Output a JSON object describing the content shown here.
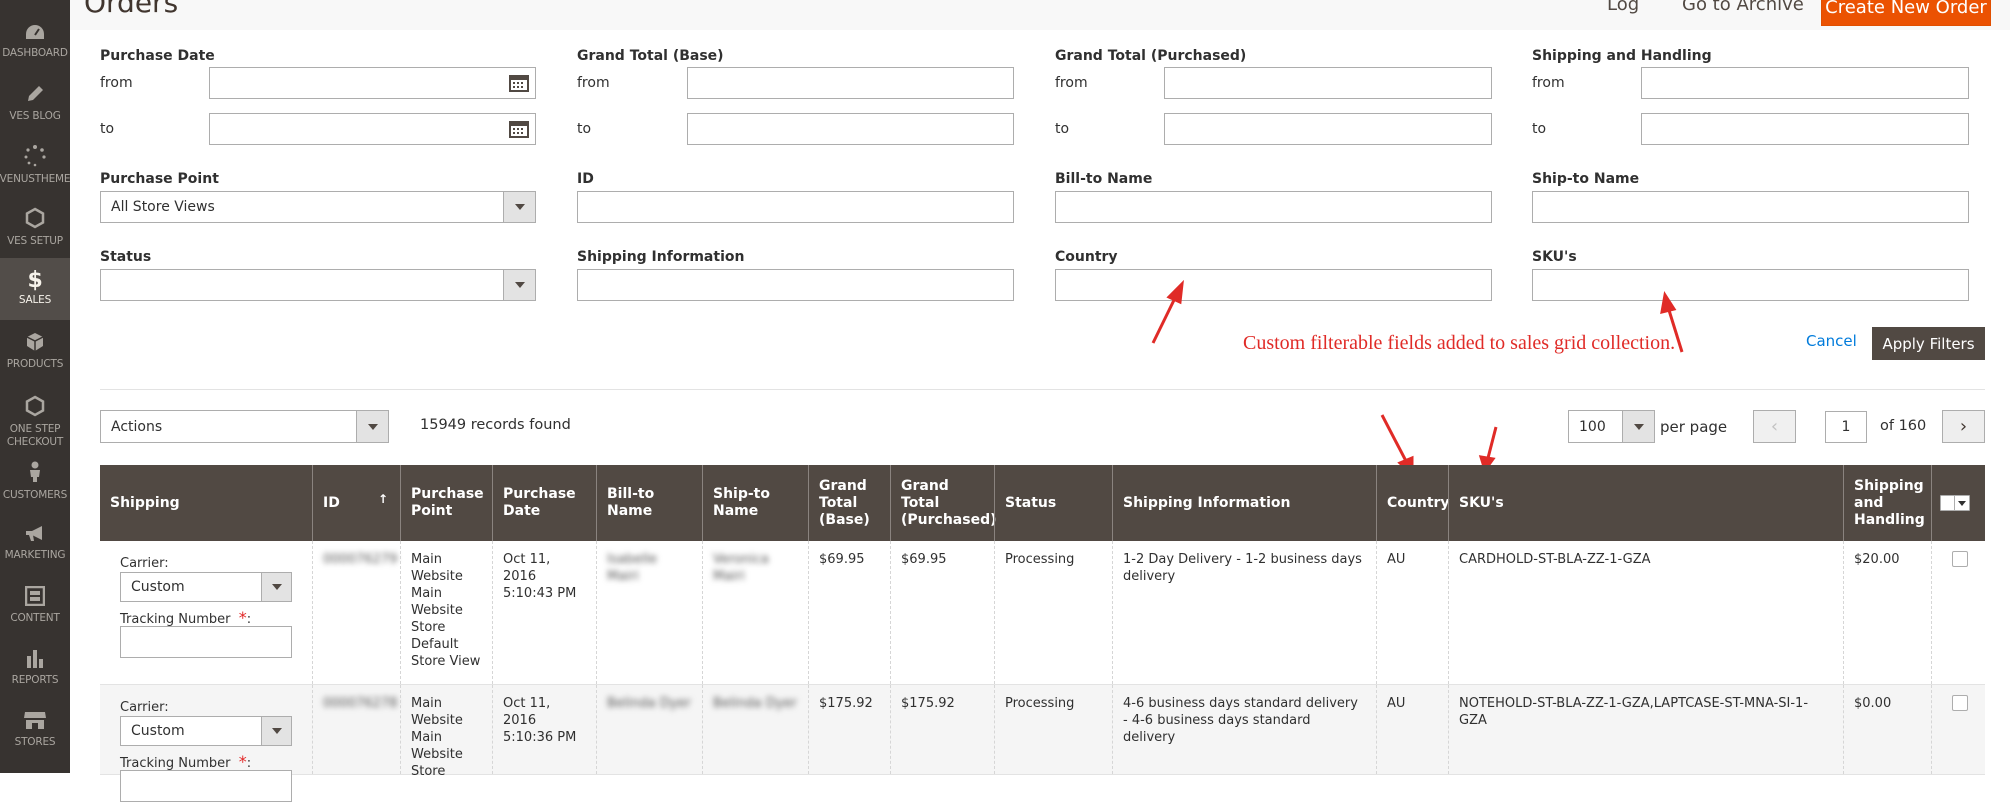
{
  "sidebar": {
    "items": [
      {
        "icon": "dashboard-icon",
        "label": "DASHBOARD"
      },
      {
        "icon": "pencil-icon",
        "label": "VES BLOG"
      },
      {
        "icon": "dots-spinner-icon",
        "label": "VENUSTHEME"
      },
      {
        "icon": "hexagon-icon",
        "label": "VES SETUP"
      },
      {
        "icon": "dollar-icon",
        "label": "SALES"
      },
      {
        "icon": "cube-icon",
        "label": "PRODUCTS"
      },
      {
        "icon": "hexagon-icon",
        "label": "ONE STEP CHECKOUT"
      },
      {
        "icon": "person-icon",
        "label": "CUSTOMERS"
      },
      {
        "icon": "megaphone-icon",
        "label": "MARKETING"
      },
      {
        "icon": "content-icon",
        "label": "CONTENT"
      },
      {
        "icon": "bar-chart-icon",
        "label": "REPORTS"
      },
      {
        "icon": "store-icon",
        "label": "STORES"
      }
    ],
    "active": "SALES"
  },
  "header": {
    "title": "Orders",
    "log_link": "Log",
    "archive_link": "Go to Archive",
    "create_button": "Create New Order",
    "accent_color": "#eb5202"
  },
  "filters": {
    "purchase_date": {
      "label": "Purchase Date",
      "from": "from",
      "to": "to"
    },
    "grand_total_base": {
      "label": "Grand Total (Base)",
      "from": "from",
      "to": "to"
    },
    "grand_total_purchased": {
      "label": "Grand Total (Purchased)",
      "from": "from",
      "to": "to"
    },
    "shipping_handling": {
      "label": "Shipping and Handling",
      "from": "from",
      "to": "to"
    },
    "purchase_point": {
      "label": "Purchase Point",
      "value": "All Store Views"
    },
    "id": {
      "label": "ID"
    },
    "bill_to": {
      "label": "Bill-to Name"
    },
    "ship_to": {
      "label": "Ship-to Name"
    },
    "status": {
      "label": "Status",
      "value": ""
    },
    "shipping_info": {
      "label": "Shipping Information"
    },
    "country": {
      "label": "Country"
    },
    "skus": {
      "label": "SKU's"
    },
    "cancel": "Cancel",
    "apply": "Apply Filters"
  },
  "annotation": {
    "text": "Custom filterable fields added to sales grid collection.",
    "color": "#e02b27"
  },
  "toolbar": {
    "actions": "Actions",
    "records": "15949 records found",
    "per_page_value": "100",
    "per_page_label": "per page",
    "current_page": "1",
    "of_pages": "of 160"
  },
  "grid": {
    "columns": [
      "Shipping",
      "ID",
      "Purchase Point",
      "Purchase Date",
      "Bill-to Name",
      "Ship-to Name",
      "Grand Total (Base)",
      "Grand Total (Purchased)",
      "Status",
      "Shipping Information",
      "Country",
      "SKU's",
      "Shipping and Handling"
    ],
    "shipping_labels": {
      "carrier": "Carrier:",
      "carrier_value": "Custom",
      "tracking": "Tracking Number",
      "required": "*",
      "colon": ":"
    },
    "rows": [
      {
        "id": "000076279",
        "purchase_point": "Main Website Main Website Store Default Store View",
        "purchase_date": "Oct 11, 2016 5:10:43 PM",
        "bill_to": "Isabelle Mairi",
        "ship_to": "Veronica Mairi",
        "grand_total_base": "$69.95",
        "grand_total_purchased": "$69.95",
        "status": "Processing",
        "shipping_info": "1-2 Day Delivery - 1-2 business days delivery",
        "country": "AU",
        "skus": "CARDHOLD-ST-BLA-ZZ-1-GZA",
        "shipping_handling": "$20.00"
      },
      {
        "id": "000076278",
        "purchase_point": "Main Website Main Website Store",
        "purchase_date": "Oct 11, 2016 5:10:36 PM",
        "bill_to": "Belinda Dyer",
        "ship_to": "Belinda Dyer",
        "grand_total_base": "$175.92",
        "grand_total_purchased": "$175.92",
        "status": "Processing",
        "shipping_info": "4-6 business days standard delivery - 4-6 business days standard delivery",
        "country": "AU",
        "skus": "NOTEHOLD-ST-BLA-ZZ-1-GZA,LAPTCASE-ST-MNA-SI-1-GZA",
        "shipping_handling": "$0.00"
      }
    ]
  }
}
